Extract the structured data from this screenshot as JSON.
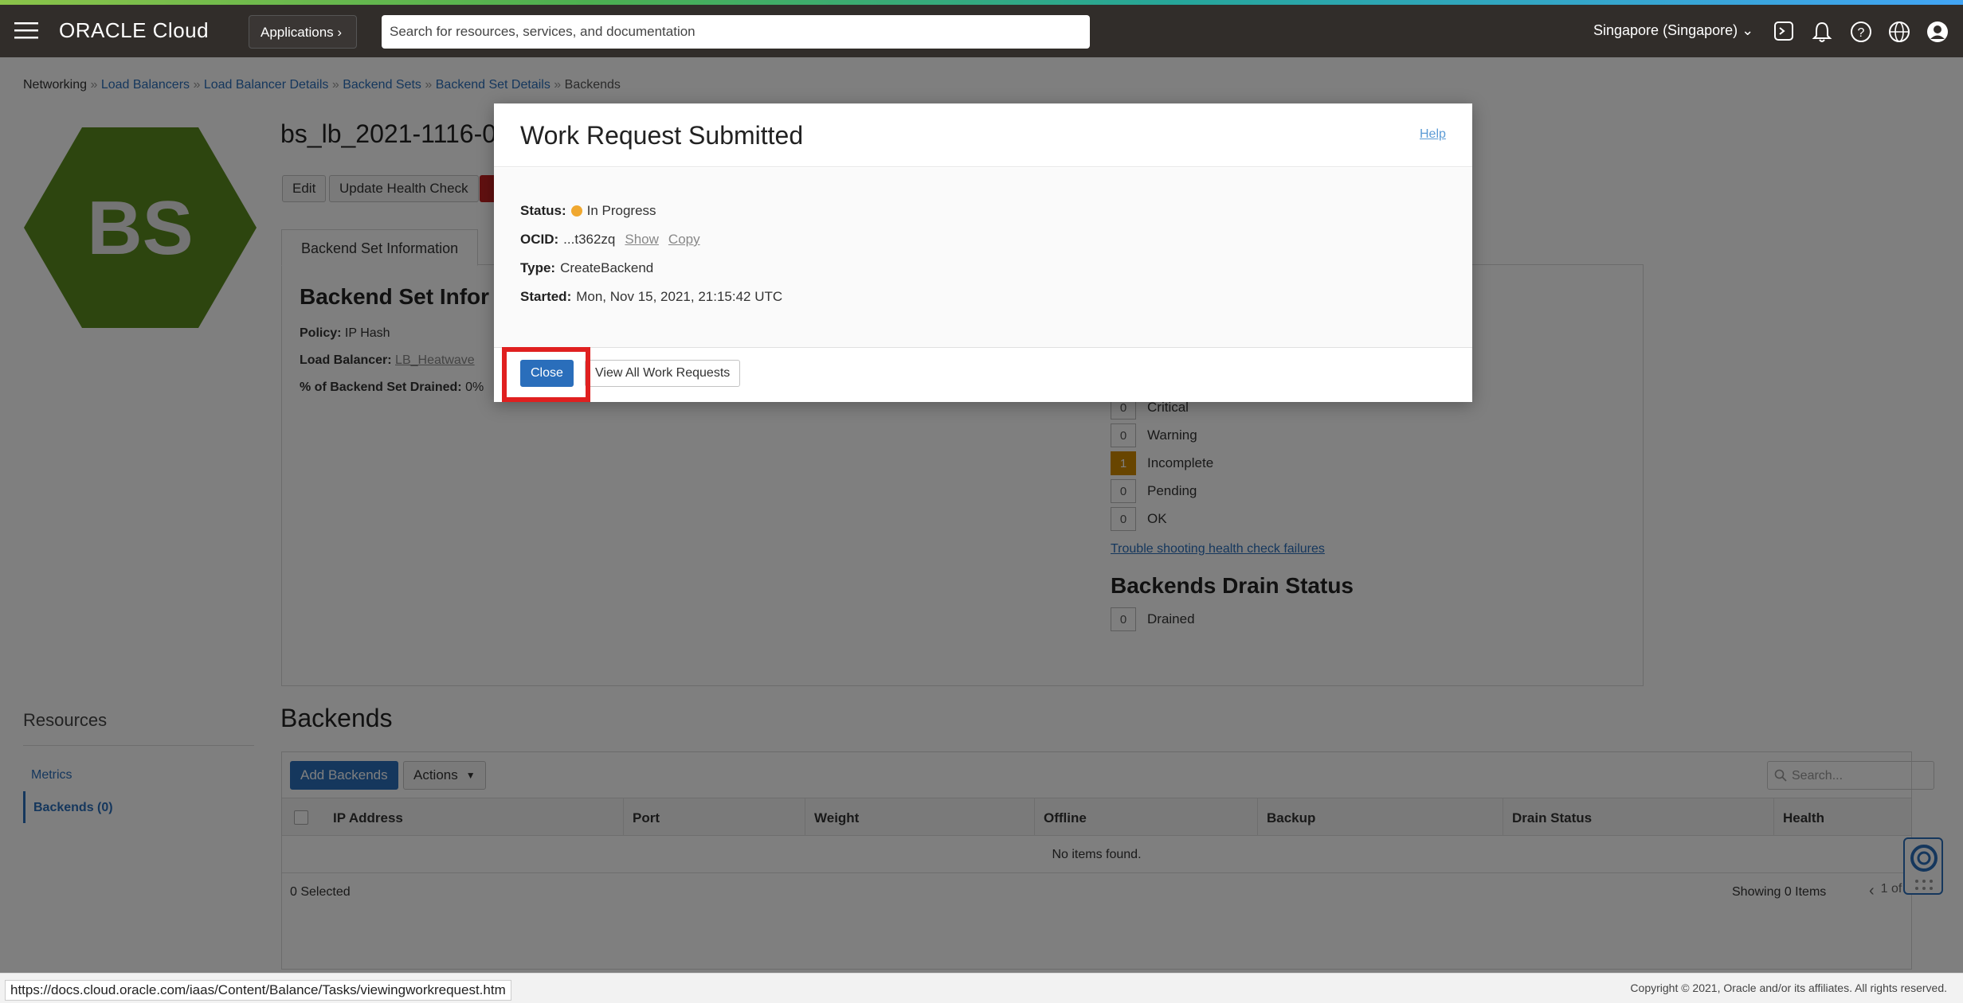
{
  "header": {
    "logo_text": "ORACLE Cloud",
    "applications_label": "Applications ›",
    "search_placeholder": "Search for resources, services, and documentation",
    "region": "Singapore (Singapore)",
    "icons": [
      "menu-icon",
      "cloud-shell-icon",
      "bell-icon",
      "help-icon",
      "globe-icon",
      "user-icon"
    ]
  },
  "breadcrumb": {
    "root": "Networking",
    "sep": "»",
    "items": [
      "Load Balancers",
      "Load Balancer Details",
      "Backend Sets",
      "Backend Set Details"
    ],
    "current": "Backends"
  },
  "resource": {
    "hex_label": "BS",
    "title": "bs_lb_2021-1116-0",
    "buttons": {
      "edit": "Edit",
      "update_health": "Update Health Check"
    },
    "tab": "Backend Set Information",
    "section_title": "Backend Set Infor",
    "policy_label": "Policy:",
    "policy_value": "IP Hash",
    "lb_label": "Load Balancer:",
    "lb_value": "LB_Heatwave",
    "drained_label": "% of Backend Set Drained:",
    "drained_value": "0%"
  },
  "health": {
    "items": [
      {
        "count": "0",
        "label": "Critical"
      },
      {
        "count": "0",
        "label": "Warning"
      },
      {
        "count": "1",
        "label": "Incomplete"
      },
      {
        "count": "0",
        "label": "Pending"
      },
      {
        "count": "0",
        "label": "OK"
      }
    ],
    "trouble_link": "Trouble shooting health check failures",
    "drain_title": "Backends Drain Status",
    "drain_count": "0",
    "drain_label": "Drained"
  },
  "resources": {
    "title": "Resources",
    "items": [
      "Metrics",
      "Backends (0)"
    ]
  },
  "backends": {
    "title": "Backends",
    "add_label": "Add Backends",
    "actions_label": "Actions",
    "search_placeholder": "Search...",
    "columns": [
      "IP Address",
      "Port",
      "Weight",
      "Offline",
      "Backup",
      "Drain Status",
      "Health"
    ],
    "empty": "No items found.",
    "selected": "0 Selected",
    "showing": "Showing 0 Items",
    "pager": "1 of 1"
  },
  "modal": {
    "title": "Work Request Submitted",
    "help": "Help",
    "status_label": "Status:",
    "status_value": "In Progress",
    "status_color": "#f0a830",
    "ocid_label": "OCID:",
    "ocid_value": "...t362zq",
    "show": "Show",
    "copy": "Copy",
    "type_label": "Type:",
    "type_value": "CreateBackend",
    "started_label": "Started:",
    "started_value": "Mon, Nov 15, 2021, 21:15:42 UTC",
    "close": "Close",
    "view_all": "View All Work Requests"
  },
  "statusbar": {
    "url": "https://docs.cloud.oracle.com/iaas/Content/Balance/Tasks/viewingworkrequest.htm",
    "copyright": "Copyright © 2021, Oracle and/or its affiliates. All rights reserved."
  },
  "colors": {
    "header": "#312d2a",
    "accent_blue": "#2a6ebb",
    "hex_green": "#5a8a1e",
    "highlight_red": "#e02020",
    "incomplete": "#d08a00"
  }
}
